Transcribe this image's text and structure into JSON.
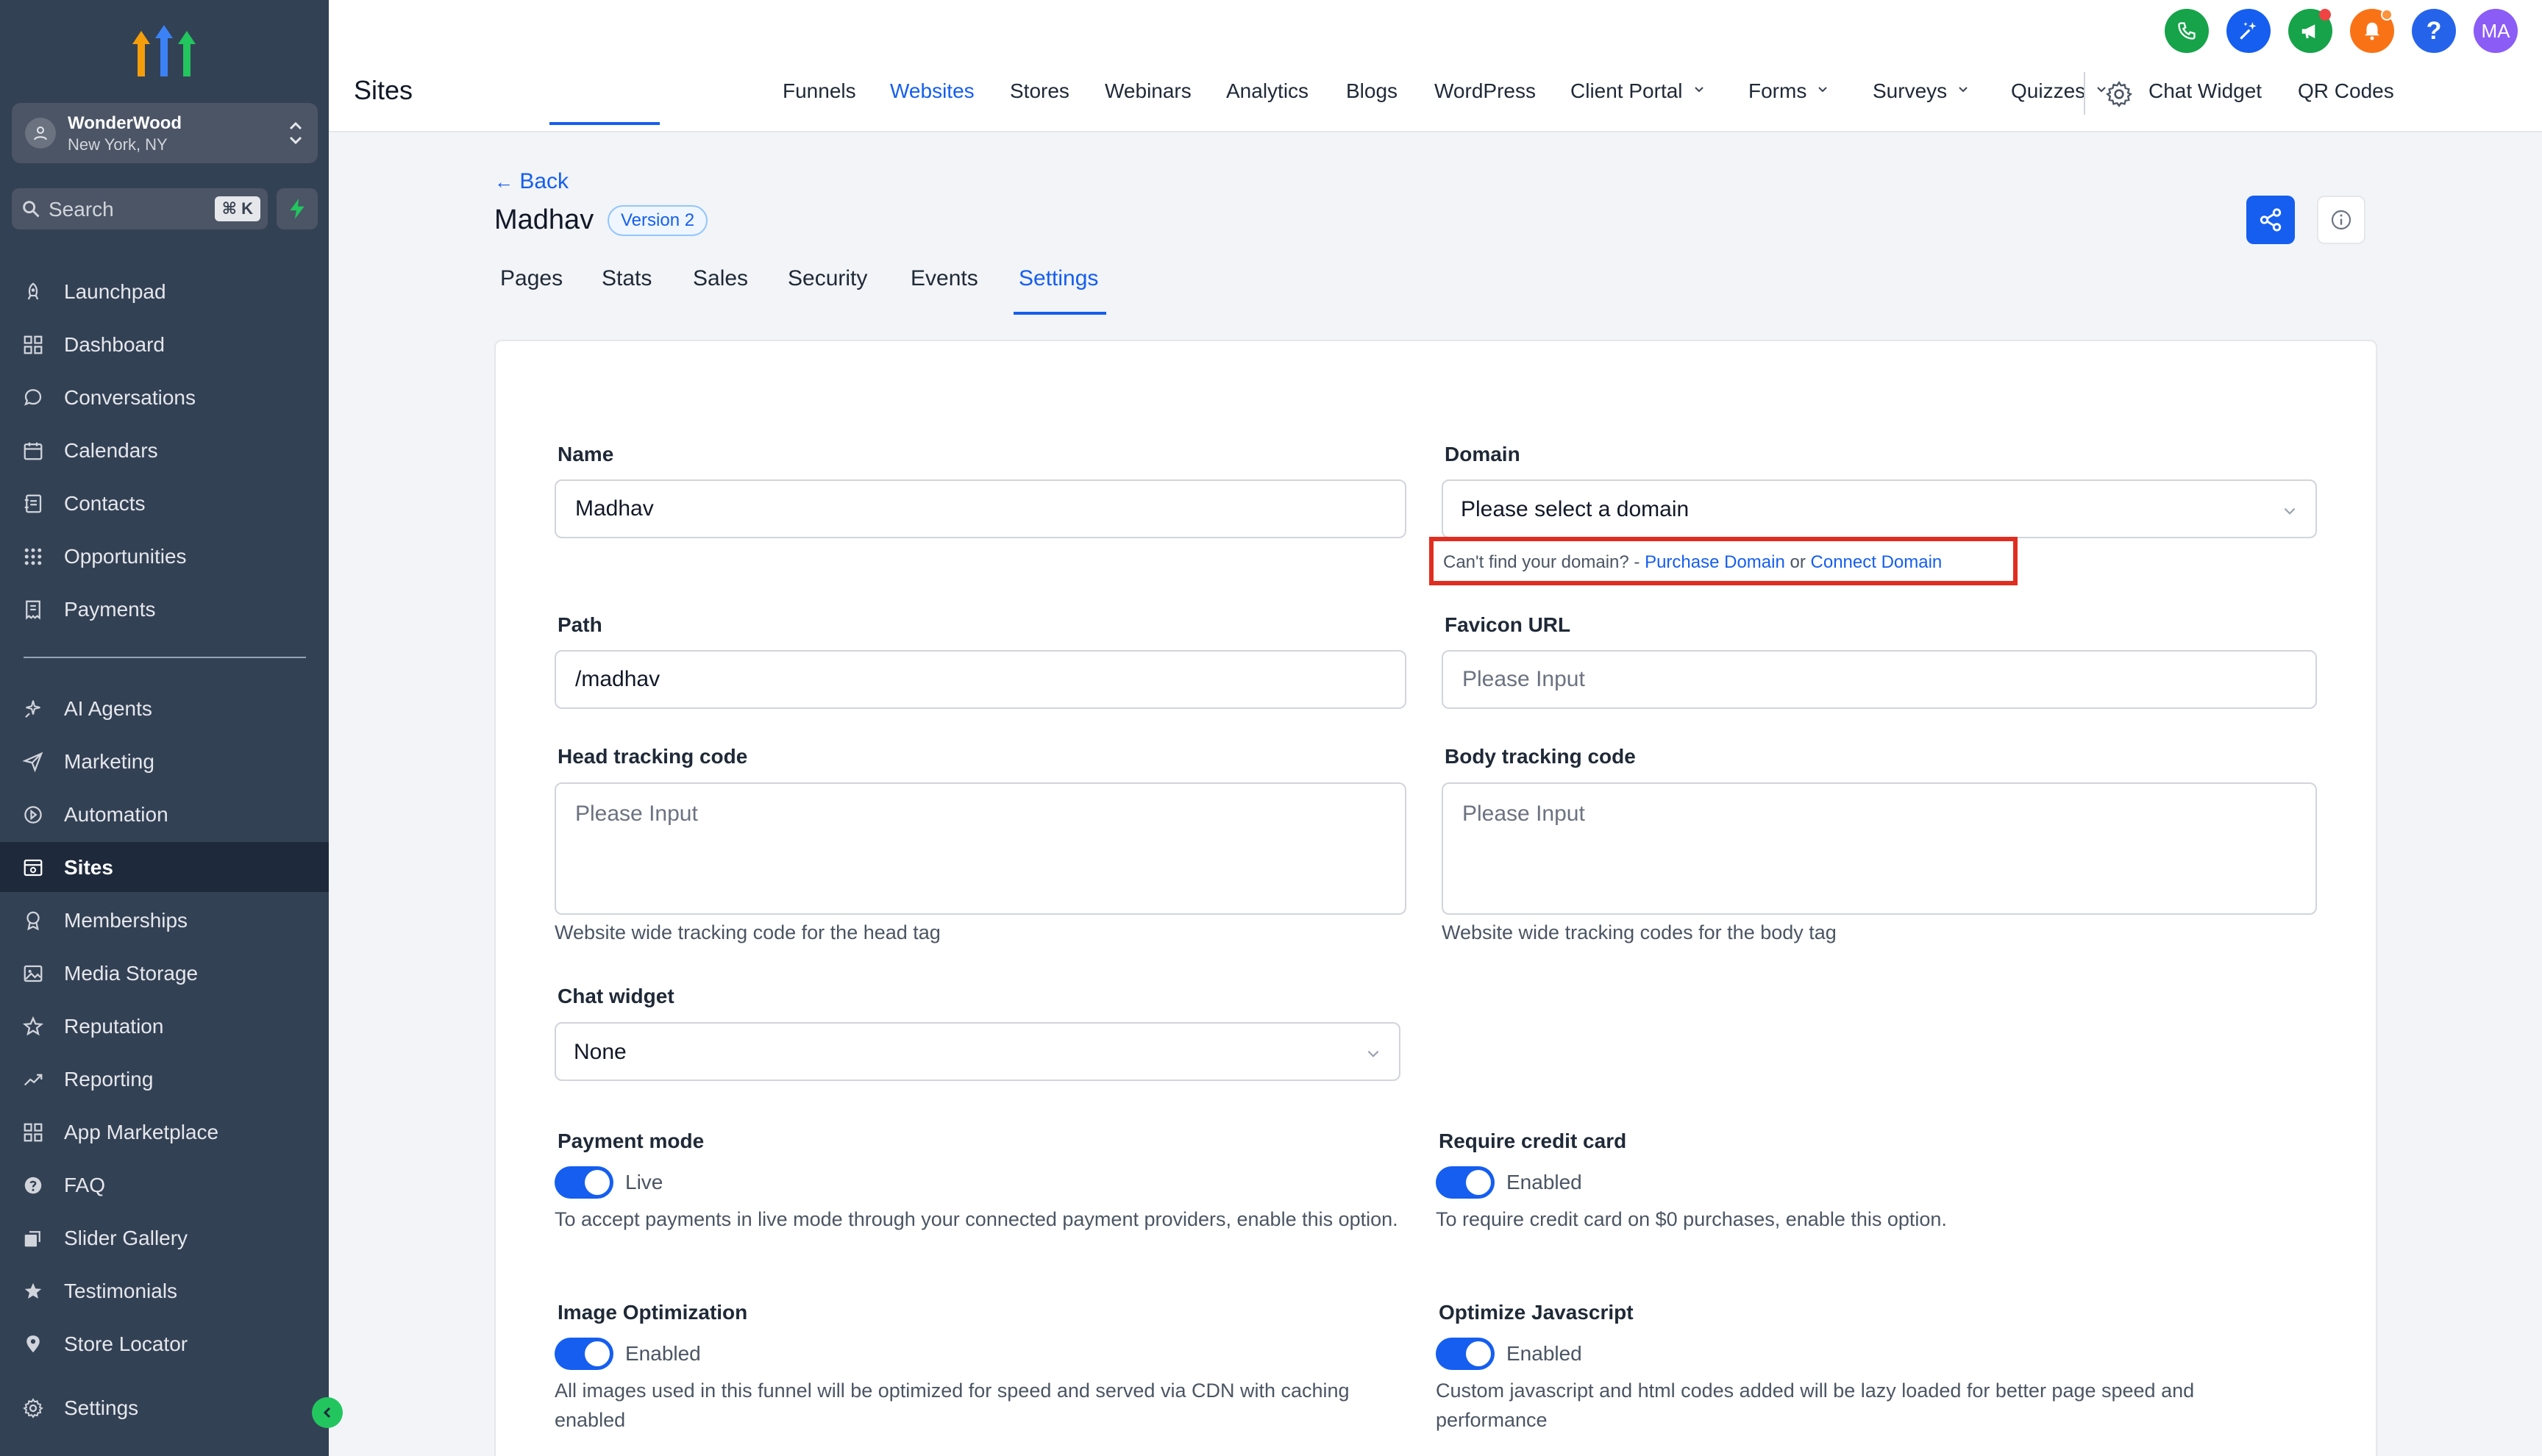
{
  "sidebar": {
    "location": {
      "name": "WonderWood",
      "city": "New York, NY"
    },
    "search": {
      "label": "Search",
      "shortcut": "⌘ K"
    },
    "items": [
      {
        "label": "Launchpad",
        "icon": "rocket-icon"
      },
      {
        "label": "Dashboard",
        "icon": "grid-icon"
      },
      {
        "label": "Conversations",
        "icon": "chat-bubble-icon"
      },
      {
        "label": "Calendars",
        "icon": "calendar-icon"
      },
      {
        "label": "Contacts",
        "icon": "contacts-icon"
      },
      {
        "label": "Opportunities",
        "icon": "pipeline-icon"
      },
      {
        "label": "Payments",
        "icon": "receipt-icon"
      },
      {
        "label": "AI Agents",
        "icon": "sparkle-icon"
      },
      {
        "label": "Marketing",
        "icon": "paper-plane-icon"
      },
      {
        "label": "Automation",
        "icon": "automation-icon"
      },
      {
        "label": "Sites",
        "icon": "browser-window-icon"
      },
      {
        "label": "Memberships",
        "icon": "award-icon"
      },
      {
        "label": "Media Storage",
        "icon": "image-icon"
      },
      {
        "label": "Reputation",
        "icon": "star-icon"
      },
      {
        "label": "Reporting",
        "icon": "trend-icon"
      },
      {
        "label": "App Marketplace",
        "icon": "apps-icon"
      },
      {
        "label": "FAQ",
        "icon": "question-icon"
      },
      {
        "label": "Slider Gallery",
        "icon": "gallery-icon"
      },
      {
        "label": "Testimonials",
        "icon": "star-outline-icon"
      },
      {
        "label": "Store Locator",
        "icon": "map-pin-icon"
      },
      {
        "label": "Settings",
        "icon": "gear-icon"
      }
    ],
    "active_item": "Sites"
  },
  "topbar": {
    "title": "Sites",
    "tabs": [
      "Funnels",
      "Websites",
      "Stores",
      "Webinars",
      "Analytics",
      "Blogs",
      "WordPress",
      "Client Portal",
      "Forms",
      "Surveys",
      "Quizzes",
      "Chat Widget",
      "QR Codes"
    ],
    "active_tab": "Websites",
    "avatar_initials": "MA"
  },
  "header": {
    "back_label": "Back",
    "site_name": "Madhav",
    "version": "Version 2",
    "subtabs": [
      "Pages",
      "Stats",
      "Sales",
      "Security",
      "Events",
      "Settings"
    ],
    "active_subtab": "Settings"
  },
  "form": {
    "name": {
      "label": "Name",
      "value": "Madhav"
    },
    "domain": {
      "label": "Domain",
      "placeholder": "Please select a domain",
      "hint": "Can't find your domain? -",
      "purchase_link": "Purchase Domain",
      "or": "or",
      "connect_link": "Connect Domain"
    },
    "path": {
      "label": "Path",
      "value": "/madhav"
    },
    "favicon": {
      "label": "Favicon URL",
      "placeholder": "Please Input"
    },
    "head_code": {
      "label": "Head tracking code",
      "placeholder": "Please Input",
      "help": "Website wide tracking code for the head tag"
    },
    "body_code": {
      "label": "Body tracking code",
      "placeholder": "Please Input",
      "help": "Website wide tracking codes for the body tag"
    },
    "chat_widget": {
      "label": "Chat widget",
      "value": "None"
    },
    "payment_mode": {
      "label": "Payment mode",
      "state": "Live",
      "help": "To accept payments in live mode through your connected payment providers, enable this option."
    },
    "require_card": {
      "label": "Require credit card",
      "state": "Enabled",
      "help": "To require credit card on $0 purchases, enable this option."
    },
    "image_opt": {
      "label": "Image Optimization",
      "state": "Enabled",
      "help": "All images used in this funnel will be optimized for speed and served via CDN with caching enabled"
    },
    "js_opt": {
      "label": "Optimize Javascript",
      "state": "Enabled",
      "help": "Custom javascript and html codes added will be lazy loaded for better page speed and performance"
    }
  },
  "colors": {
    "accent": "#155eef",
    "sidebar_bg": "#334155",
    "highlight": "#e02d1f"
  }
}
